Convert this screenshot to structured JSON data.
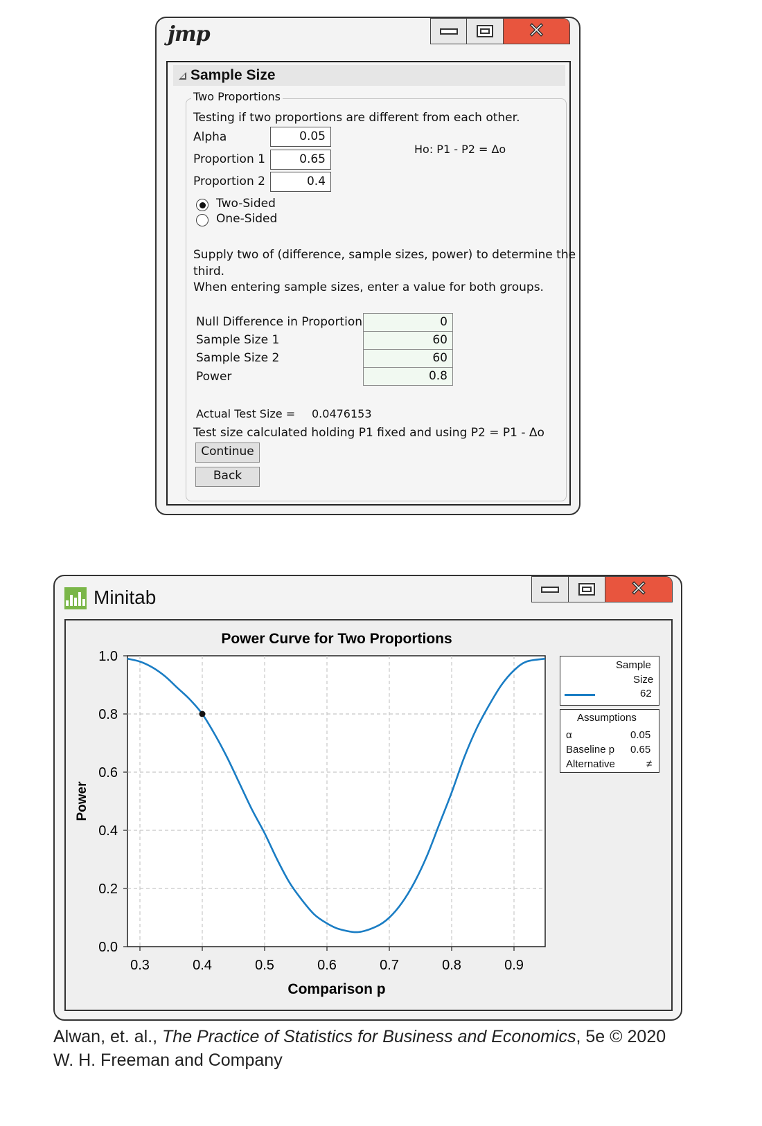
{
  "jmp": {
    "logo": "jmp",
    "panel_title": "Sample Size",
    "group_title": "Two Proportions",
    "description": "Testing if two proportions are different from each other.",
    "alpha_label": "Alpha",
    "alpha_value": "0.05",
    "prop1_label": "Proportion 1",
    "prop1_value": "0.65",
    "prop2_label": "Proportion 2",
    "prop2_value": "0.4",
    "hypothesis": "Ho: P1 - P2 = Δo",
    "radio_two_sided": "Two-Sided",
    "radio_one_sided": "One-Sided",
    "selected_option": "Two-Sided",
    "instructions_1": "Supply two of (difference, sample sizes, power) to determine the",
    "instructions_2": "third.",
    "instructions_3": "When entering sample sizes, enter a value for both groups.",
    "null_diff_label": "Null Difference in Proportion",
    "null_diff_value": "0",
    "sample1_label": "Sample Size 1",
    "sample1_value": "60",
    "sample2_label": "Sample Size 2",
    "sample2_value": "60",
    "power_label": "Power",
    "power_value": "0.8",
    "actual_test_size_label": "Actual Test Size =",
    "actual_test_size_value": "0.0476153",
    "test_size_note": "Test size calculated holding P1 fixed and using P2 = P1 - Δo",
    "continue_button": "Continue",
    "back_button": "Back"
  },
  "minitab": {
    "window_title": "Minitab",
    "legend": {
      "header_1": "Sample",
      "header_2": "Size",
      "value": "62",
      "color": "#1a7dc4"
    },
    "assumptions": {
      "title": "Assumptions",
      "rows": [
        {
          "label": "α",
          "value": "0.05"
        },
        {
          "label": "Baseline p",
          "value": "0.65"
        },
        {
          "label": "Alternative",
          "value": "≠"
        }
      ]
    }
  },
  "chart_data": {
    "type": "line",
    "title": "Power Curve for Two Proportions",
    "xlabel": "Comparison p",
    "ylabel": "Power",
    "xlim": [
      0.28,
      0.95
    ],
    "ylim": [
      0.0,
      1.0
    ],
    "xticks": [
      "0.3",
      "0.4",
      "0.5",
      "0.6",
      "0.7",
      "0.8",
      "0.9"
    ],
    "yticks": [
      "0.0",
      "0.2",
      "0.4",
      "0.6",
      "0.8",
      "1.0"
    ],
    "grid": true,
    "series": [
      {
        "name": "62",
        "color": "#1a7dc4",
        "x": [
          0.28,
          0.3,
          0.32,
          0.34,
          0.36,
          0.38,
          0.4,
          0.42,
          0.44,
          0.46,
          0.48,
          0.5,
          0.52,
          0.54,
          0.56,
          0.58,
          0.6,
          0.62,
          0.65,
          0.68,
          0.7,
          0.72,
          0.74,
          0.76,
          0.78,
          0.8,
          0.82,
          0.84,
          0.86,
          0.88,
          0.9,
          0.92,
          0.95
        ],
        "y": [
          0.99,
          0.98,
          0.96,
          0.93,
          0.89,
          0.85,
          0.8,
          0.73,
          0.65,
          0.56,
          0.47,
          0.39,
          0.3,
          0.22,
          0.16,
          0.11,
          0.08,
          0.06,
          0.05,
          0.07,
          0.1,
          0.15,
          0.22,
          0.31,
          0.42,
          0.53,
          0.65,
          0.75,
          0.83,
          0.9,
          0.95,
          0.98,
          0.99
        ]
      }
    ],
    "highlight_point": {
      "x": 0.4,
      "y": 0.8
    },
    "legend": "right"
  },
  "caption": {
    "line1_prefix": "Alwan, et. al., ",
    "line1_title": "The Practice of Statistics for Business and Economics",
    "line1_suffix": ", 5e © 2020",
    "line2": "W. H. Freeman and Company"
  }
}
